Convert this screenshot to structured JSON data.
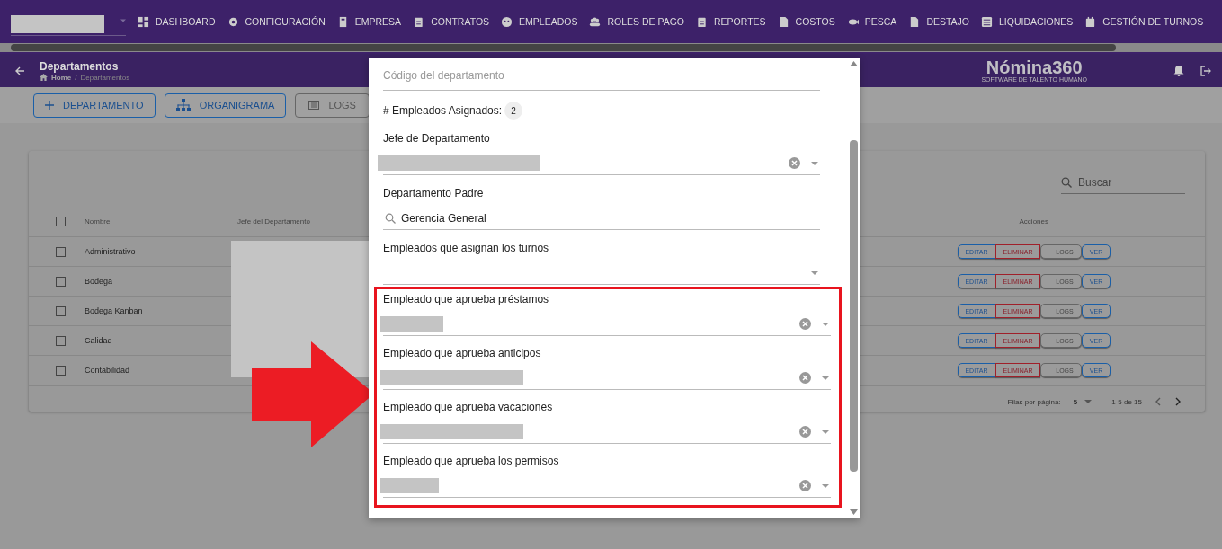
{
  "nav": {
    "account_redacted": true,
    "items": [
      {
        "label": "DASHBOARD"
      },
      {
        "label": "CONFIGURACIÓN"
      },
      {
        "label": "EMPRESA"
      },
      {
        "label": "CONTRATOS"
      },
      {
        "label": "EMPLEADOS"
      },
      {
        "label": "ROLES DE PAGO"
      },
      {
        "label": "REPORTES"
      },
      {
        "label": "COSTOS"
      },
      {
        "label": "PESCA"
      },
      {
        "label": "DESTAJO"
      },
      {
        "label": "LIQUIDACIONES"
      },
      {
        "label": "GESTIÓN DE TURNOS"
      }
    ]
  },
  "header": {
    "title": "Departamentos",
    "breadcrumb": [
      "Home",
      "Departamentos"
    ],
    "separator": "/",
    "logo": "Nómina360",
    "tagline": "SOFTWARE DE TALENTO HUMANO"
  },
  "toolbar": [
    {
      "label": "DEPARTAMENTO",
      "kind": "add"
    },
    {
      "label": "ORGANIGRAMA",
      "kind": "org"
    },
    {
      "label": "LOGS",
      "kind": "logs"
    }
  ],
  "table": {
    "search": {
      "placeholder": "Buscar"
    },
    "columns": [
      "Nombre",
      "Jefe del Departamento",
      "Acciones"
    ],
    "all_checked": false,
    "boss_redacted": true,
    "rows": [
      {
        "name": "Administrativo",
        "checked": false,
        "actions": [
          "EDITAR",
          "ELIMINAR",
          "LOGS",
          "VER"
        ]
      },
      {
        "name": "Bodega",
        "checked": false,
        "actions": [
          "EDITAR",
          "ELIMINAR",
          "LOGS",
          "VER"
        ]
      },
      {
        "name": "Bodega Kanban",
        "checked": false,
        "actions": [
          "EDITAR",
          "ELIMINAR",
          "LOGS",
          "VER"
        ]
      },
      {
        "name": "Calidad",
        "checked": false,
        "actions": [
          "EDITAR",
          "ELIMINAR",
          "LOGS",
          "VER"
        ]
      },
      {
        "name": "Contabilidad",
        "checked": false,
        "actions": [
          "EDITAR",
          "ELIMINAR",
          "LOGS",
          "VER"
        ]
      }
    ],
    "footer": {
      "rows_label": "Filas por página:",
      "rows_per_page": "5",
      "range": "1-5 de 15"
    }
  },
  "dialog": {
    "fields": [
      {
        "kind": "text",
        "placeholder": "Código del departamento"
      },
      {
        "kind": "count",
        "label": "# Empleados Asignados:",
        "value": "2"
      },
      {
        "kind": "select",
        "label": "Jefe de Departamento",
        "redacted": true,
        "clearable": true
      },
      {
        "kind": "search",
        "label": "Departamento Padre",
        "value": "Gerencia General"
      },
      {
        "kind": "select",
        "label": "Empleados que asignan los turnos",
        "redacted": false,
        "clearable": false
      }
    ],
    "highlighted": true,
    "highlighted_fields": [
      {
        "kind": "select",
        "label": "Empleado que aprueba préstamos",
        "redacted": true,
        "clearable": true
      },
      {
        "kind": "select",
        "label": "Empleado que aprueba anticipos",
        "redacted": true,
        "clearable": true
      },
      {
        "kind": "select",
        "label": "Empleado que aprueba vacaciones",
        "redacted": true,
        "clearable": true
      },
      {
        "kind": "select",
        "label": "Empleado que aprueba los permisos",
        "redacted": true,
        "clearable": true
      }
    ]
  }
}
